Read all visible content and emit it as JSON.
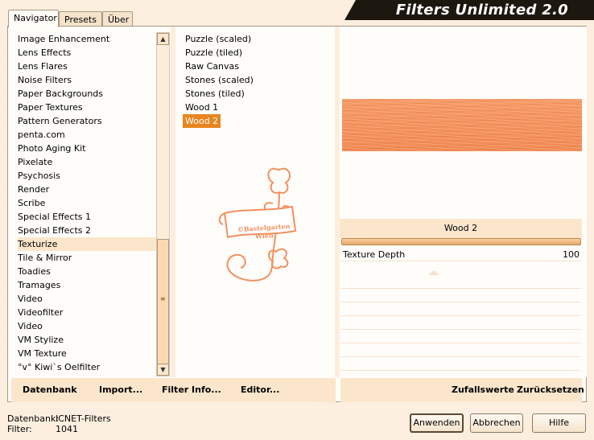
{
  "window": {
    "title": "Filters Unlimited 2.0"
  },
  "tabs": [
    {
      "label": "Navigator",
      "active": true
    },
    {
      "label": "Presets",
      "active": false
    },
    {
      "label": "Über",
      "active": false
    }
  ],
  "categories": {
    "items": [
      "Image Enhancement",
      "Lens Effects",
      "Lens Flares",
      "Noise Filters",
      "Paper Backgrounds",
      "Paper Textures",
      "Pattern Generators",
      "penta.com",
      "Photo Aging Kit",
      "Pixelate",
      "Psychosis",
      "Render",
      "Scribe",
      "Special Effects 1",
      "Special Effects 2",
      "Texturize",
      "Tile & Mirror",
      "Toadies",
      "Tramages",
      "Video",
      "Videofilter",
      "Video",
      "VM Stylize",
      "VM Texture",
      "°v° Kiwi`s Oelfilter"
    ],
    "selected": "Texturize"
  },
  "filters": {
    "items": [
      "Puzzle (scaled)",
      "Puzzle (tiled)",
      "Raw Canvas",
      "Stones (scaled)",
      "Stones (tiled)",
      "Wood 1",
      "Wood 2"
    ],
    "selected": "Wood 2"
  },
  "watermark": {
    "line1": "©Bastelgarten",
    "line2": "Wien"
  },
  "preview": {
    "filter_name": "Wood 2"
  },
  "parameters": [
    {
      "label": "Texture Depth",
      "value": "100"
    }
  ],
  "bottom_left_links": [
    "Datenbank",
    "Import...",
    "Filter Info...",
    "Editor..."
  ],
  "bottom_right_links": [
    "Zufallswerte",
    "Zurücksetzen"
  ],
  "status": {
    "database_label": "Datenbank:",
    "database_value": "ICNET-Filters",
    "filter_label": "Filter:",
    "filter_value": "1041"
  },
  "buttons": {
    "apply": "Anwenden",
    "cancel": "Abbrechen",
    "help": "Hilfe"
  },
  "colors": {
    "accent": "#e8851f",
    "preview_texture": "#f59561",
    "background": "#fcefdf"
  }
}
